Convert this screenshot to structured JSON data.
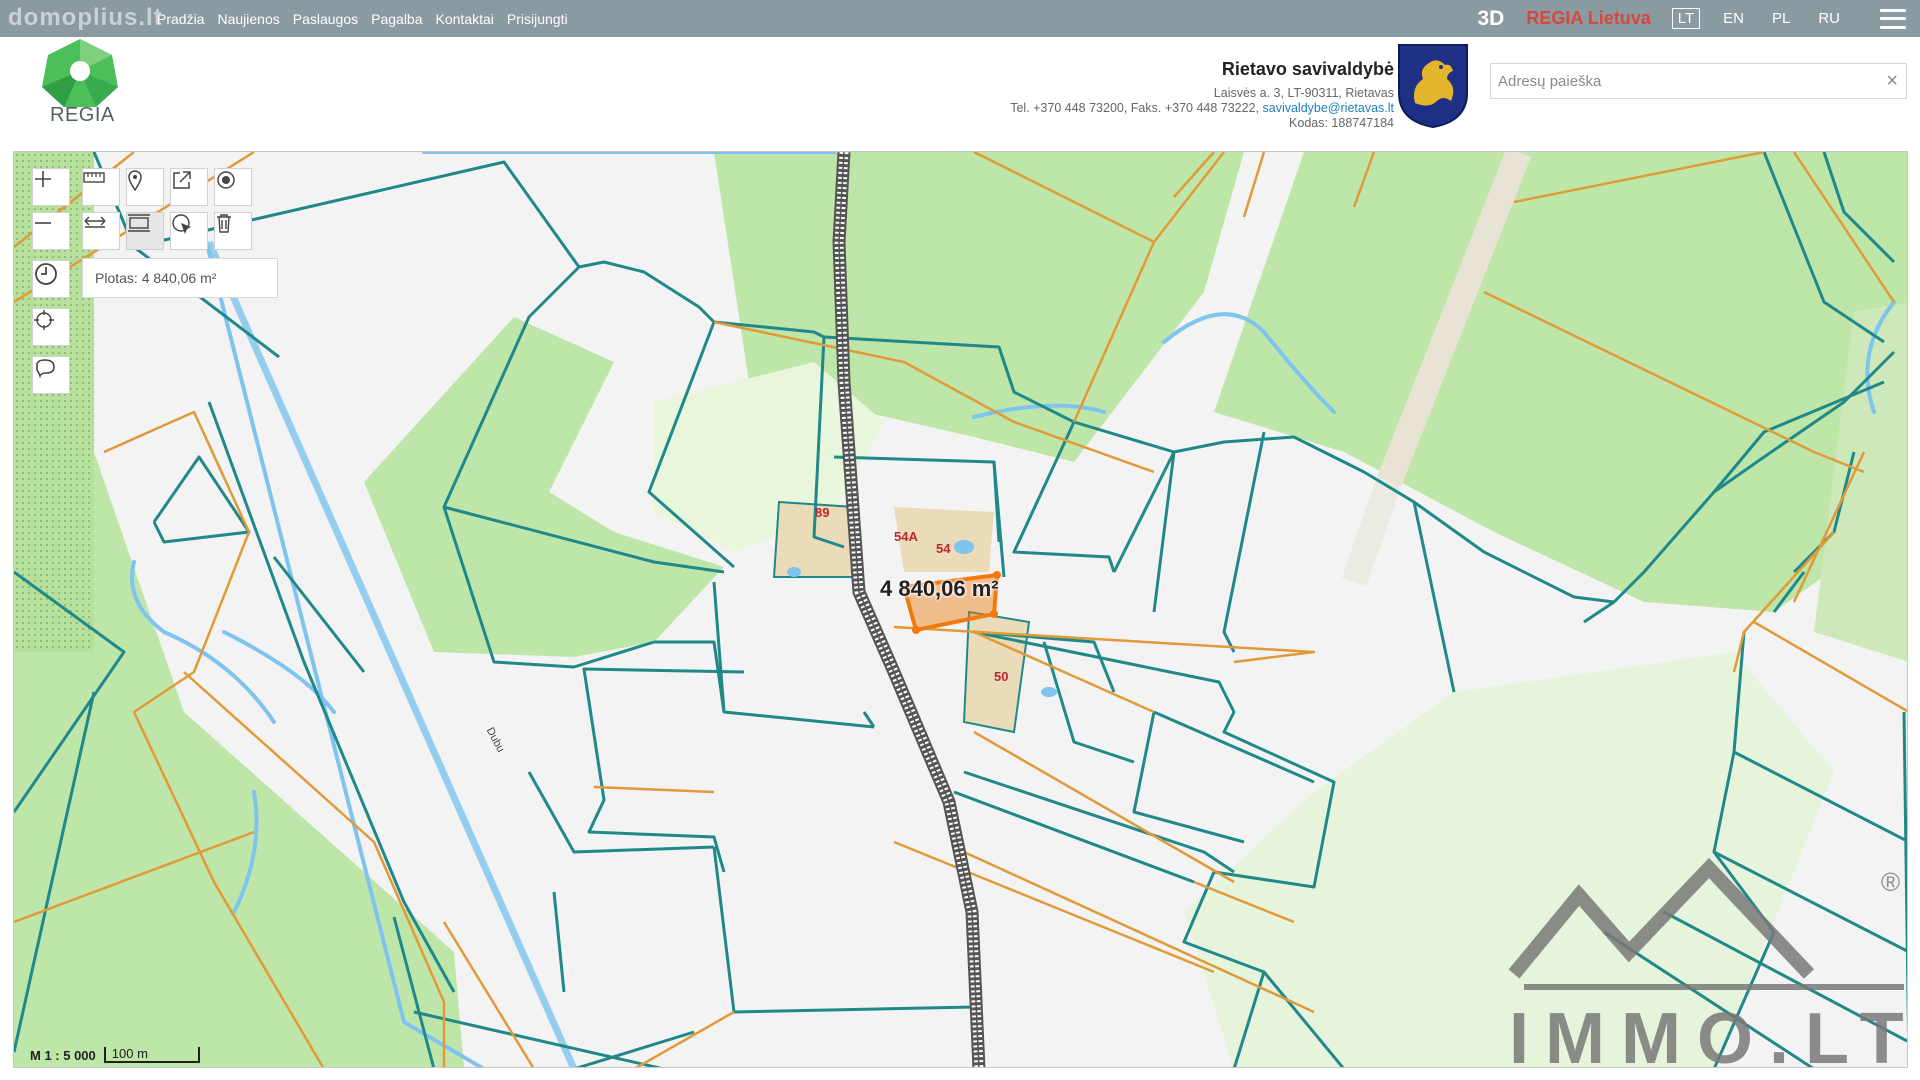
{
  "topbar": {
    "watermark": "domoplius.lt",
    "nav": [
      "Pradžia",
      "Naujienos",
      "Paslaugos",
      "Pagalba",
      "Kontaktai",
      "Prisijungti"
    ],
    "btn_3d": "3D",
    "regia_lietuva": "REGIA Lietuva",
    "languages": [
      "LT",
      "EN",
      "PL",
      "RU"
    ],
    "active_language": "LT"
  },
  "header": {
    "logo_text": "REGIA",
    "municipality": {
      "name": "Rietavo savivaldybė",
      "address": "Laisvės a. 3, LT-90311, Rietavas",
      "phone_fax": "Tel. +370 448 73200, Faks. +370 448 73222, ",
      "email": "savivaldybe@rietavas.lt",
      "code": "Kodas: 188747184"
    },
    "search": {
      "placeholder": "Adresų paieška",
      "value": "",
      "clear": "×"
    }
  },
  "map": {
    "area_panel": "Plotas: 4 840,06 m²",
    "measure_label": "4 840,06 m²",
    "scale_ratio": "M 1 : 5 000",
    "scale_bar": "100 m",
    "parcel_numbers": [
      "89",
      "54A",
      "54",
      "50"
    ],
    "road_name": "Dubu",
    "watermark_text": "IMMO.LT",
    "watermark_reg": "®",
    "colors": {
      "forest": "#bfe6a9",
      "parcel_border": "#21888a",
      "boundary_orange": "#e09a38",
      "water": "#7ec4ef",
      "measured_area": "#f07a10",
      "yard": "#eadcb8"
    }
  },
  "tools": {
    "zoom_in": "zoom-in-icon",
    "zoom_out": "zoom-out-icon",
    "history": "history-icon",
    "locate": "crosshair-icon",
    "lasso": "lasso-icon",
    "ruler": "ruler-icon",
    "marker": "map-marker-icon",
    "share": "share-icon",
    "point": "point-icon",
    "measure_distance": "measure-distance-icon",
    "measure_area": "measure-area-icon",
    "select_cursor": "select-cursor-icon",
    "delete": "trash-icon"
  }
}
